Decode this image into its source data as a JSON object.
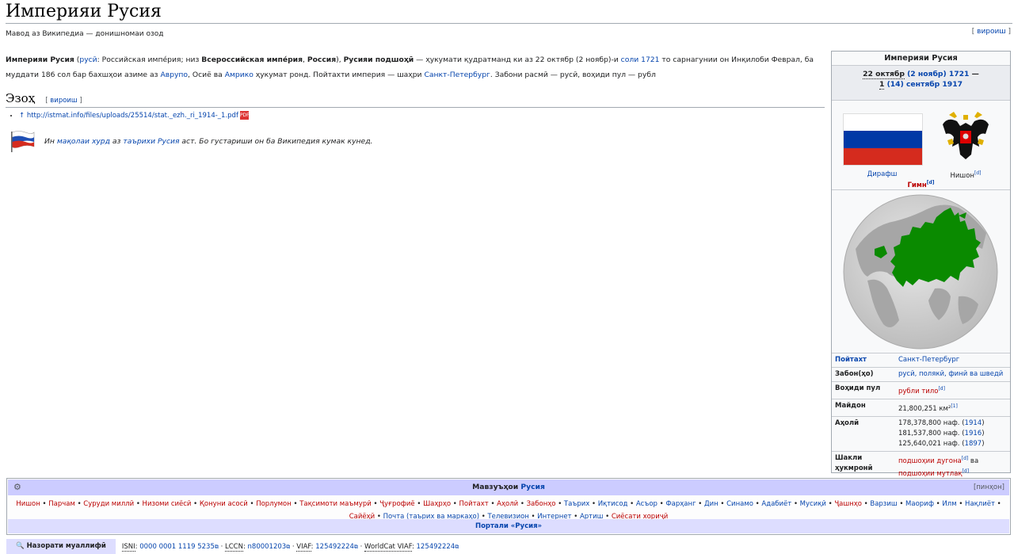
{
  "page": {
    "title": "Империяи Русия",
    "tagline": "Мавод аз Википедиа — донишномаи озод",
    "edit_label": "вироиш"
  },
  "lead": {
    "name_bold": "Империяи Русия",
    "lang_link": "русӣ",
    "lang_text": ": Российская импе́рия; низ ",
    "alt1": "Всероссийская импе́рия",
    "alt2": "Россия",
    "alt3": "Русияи подшоҳӣ",
    "text1": " — ҳукумати қудратманд ки аз 22 октябр (2 ноябр)-и ",
    "year_link": "соли 1721",
    "text2": " то сарнагунии он Инқилоби Феврал, ба муддати 186 сол бар бахшҳои азиме аз ",
    "europe": "Аврупо",
    "text3": ", Осиё ва ",
    "america": "Амрико",
    "text4": " ҳукумат ронд. Пойтахти империя — шаҳри ",
    "capital": "Санкт-Петербург",
    "text5": ". Забони расмӣ — русӣ, воҳиди пул — рубл"
  },
  "section": {
    "heading": "Эзоҳ",
    "edit_label": "вироиш"
  },
  "refs": {
    "arrow": "↑",
    "url": "http://istmat.info/files/uploads/25514/stat._ezh._ri_1914-_1.pdf",
    "pdf_icon": "PDF"
  },
  "stub": {
    "t1": "Ин ",
    "link1": "мақолаи хурд",
    "t2": " аз ",
    "link2": "таърихи Русия",
    "t3": " аст. Бо густариши он ба Википедия кумак кунед."
  },
  "infobox": {
    "title": "Империяи Русия",
    "date_start": "22 октябр",
    "date_start_alt": "(2 ноябр)",
    "year_start": "1721",
    "dash": "—",
    "date_end_day": "1",
    "date_end_rest": "(14) сентябр 1917",
    "flag_caption": "Дирафш",
    "coat_caption": "Нишон",
    "d_mark": "[d]",
    "anthem": "Гимн",
    "rows": [
      {
        "key": "Пойтахт",
        "value": "Санкт-Петербург"
      },
      {
        "key": "Забон(ҳо)",
        "value": "русӣ, полякӣ, финӣ ва шведӣ"
      },
      {
        "key": "Воҳиди пул",
        "value": "рубли тило"
      },
      {
        "key": "Майдон",
        "value": "21,800,251 км²",
        "ref": "[1]"
      },
      {
        "key": "Аҳолӣ",
        "p1": "178,378,800 наф.",
        "y1": "1914",
        "p2": "181,537,800 наф.",
        "y2": "1916",
        "p3": "125,640,021 наф.",
        "y3": "1897"
      },
      {
        "key": "Шакли ҳукмронӣ",
        "v1": "подшоҳии дугона",
        "v_and": " ва",
        "v2": "подшоҳии мутлақ"
      }
    ]
  },
  "navbox": {
    "title_prefix": "Мавзуъҳои ",
    "title_link": "Русия",
    "hide": "[пинҳон]",
    "items": [
      "Нишон",
      "Парчам",
      "Суруди миллӣ",
      "Низоми сиёсӣ",
      "Қонуни асосӣ",
      "Порлумон",
      "Тақсимоти маъмурӣ",
      "Ҷуғрофиё",
      "Шаҳрҳо",
      "Пойтахт",
      "Аҳолӣ",
      "Забонҳо",
      "Таърих",
      "Иқтисод",
      "Асъор",
      "Фарҳанг",
      "Дин",
      "Синамо",
      "Адабиёт",
      "Мусиқӣ",
      "Ҷашнҳо",
      "Варзиш",
      "Маориф",
      "Илм",
      "Нақлиёт",
      "Сайёҳӣ",
      "Почта (таърих ва маркаҳо)",
      "Телевизион",
      "Интернет",
      "Артиш",
      "Сиёсати хориҷӣ"
    ],
    "blue_items": [
      "Таърих",
      "Иқтисод",
      "Асъор",
      "Фарҳанг",
      "Дин",
      "Синамо",
      "Адабиёт",
      "Мусиқӣ",
      "Варзиш",
      "Маориф",
      "Илм",
      "Нақлиёт",
      "Почта (таърих ва маркаҳо)",
      "Телевизион",
      "Интернет",
      "Артиш"
    ],
    "portal": "Портали «Русия»"
  },
  "authority": {
    "button": "Назорати муаллифӣ",
    "isni_label": "ISNI",
    "isni": "0000 0001 1119 5235",
    "lccn_label": "LCCN",
    "lccn": "n80001203",
    "viaf_label": "VIAF",
    "viaf": "125492224",
    "wc_label": "WorldCat VIAF",
    "wc": "125492224"
  },
  "colors": {
    "link": "#0645ad",
    "redlink": "#ba0000",
    "navbox_header": "#ccccff",
    "map_land": "#0a8a00"
  }
}
